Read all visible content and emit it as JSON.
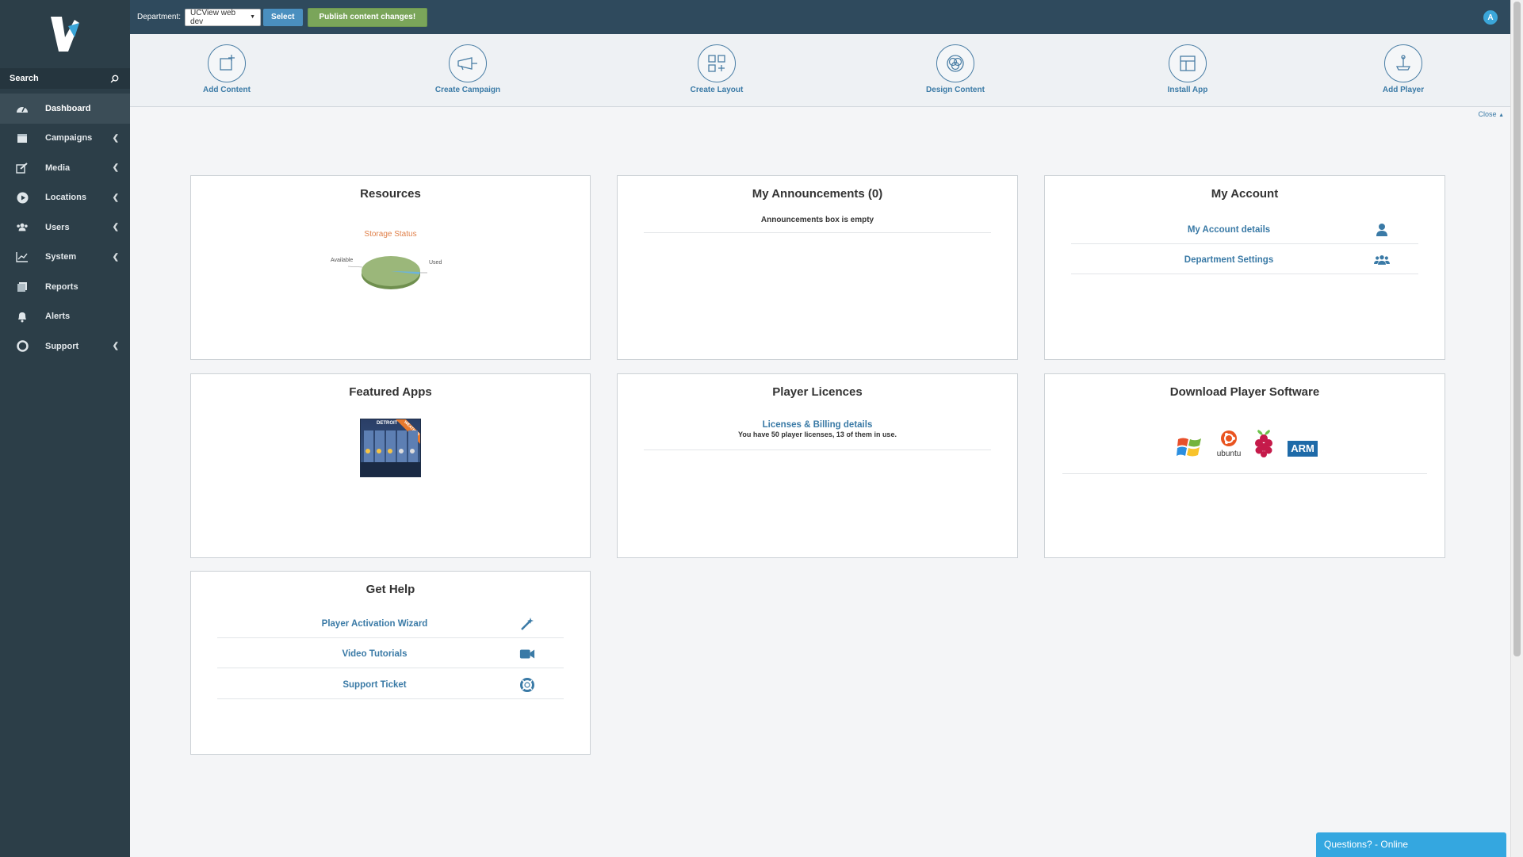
{
  "sidebar": {
    "search_label": "Search",
    "items": [
      {
        "label": "Dashboard",
        "icon": "dashboard-icon",
        "active": true,
        "chevron": false
      },
      {
        "label": "Campaigns",
        "icon": "calendar-icon",
        "active": false,
        "chevron": true
      },
      {
        "label": "Media",
        "icon": "edit-icon",
        "active": false,
        "chevron": true
      },
      {
        "label": "Locations",
        "icon": "play-circle-icon",
        "active": false,
        "chevron": true
      },
      {
        "label": "Users",
        "icon": "users-icon",
        "active": false,
        "chevron": true
      },
      {
        "label": "System",
        "icon": "chart-icon",
        "active": false,
        "chevron": true
      },
      {
        "label": "Reports",
        "icon": "reports-icon",
        "active": false,
        "chevron": false
      },
      {
        "label": "Alerts",
        "icon": "bell-icon",
        "active": false,
        "chevron": false
      },
      {
        "label": "Support",
        "icon": "lifebuoy-icon",
        "active": false,
        "chevron": true
      }
    ]
  },
  "topbar": {
    "department_label": "Department:",
    "department_value": "UCView web dev",
    "select_button": "Select",
    "publish_button": "Publish content changes!",
    "avatar_letter": "A"
  },
  "quick_actions": {
    "add_content": "Add Content",
    "create_campaign": "Create Campaign",
    "create_layout": "Create Layout",
    "design_content": "Design Content",
    "install_app": "Install App",
    "add_player": "Add Player",
    "close": "Close"
  },
  "panels": {
    "resources": {
      "title": "Resources",
      "chart_title": "Storage Status",
      "available_label": "Available",
      "used_label": "Used"
    },
    "announcements": {
      "title": "My Announcements (0)",
      "empty": "Announcements box is empty"
    },
    "account": {
      "title": "My Account",
      "details": "My Account details",
      "department_settings": "Department Settings"
    },
    "featured_apps": {
      "title": "Featured Apps",
      "app_name": "DETROIT",
      "ribbon": "WEATHER"
    },
    "licences": {
      "title": "Player Licences",
      "link": "Licenses & Billing details",
      "text": "You have 50 player licenses, 13 of them in use."
    },
    "download": {
      "title": "Download Player Software",
      "ubuntu": "ubuntu",
      "arm": "ARM"
    },
    "help": {
      "title": "Get Help",
      "wizard": "Player Activation Wizard",
      "tutorials": "Video Tutorials",
      "ticket": "Support Ticket"
    }
  },
  "chat": {
    "label": "Questions? - Online"
  },
  "colors": {
    "sidebar": "#2c3e48",
    "topbar": "#2f4a5d",
    "accent": "#3a7aa6",
    "publish": "#7aa55a",
    "chat": "#34a7e0"
  }
}
